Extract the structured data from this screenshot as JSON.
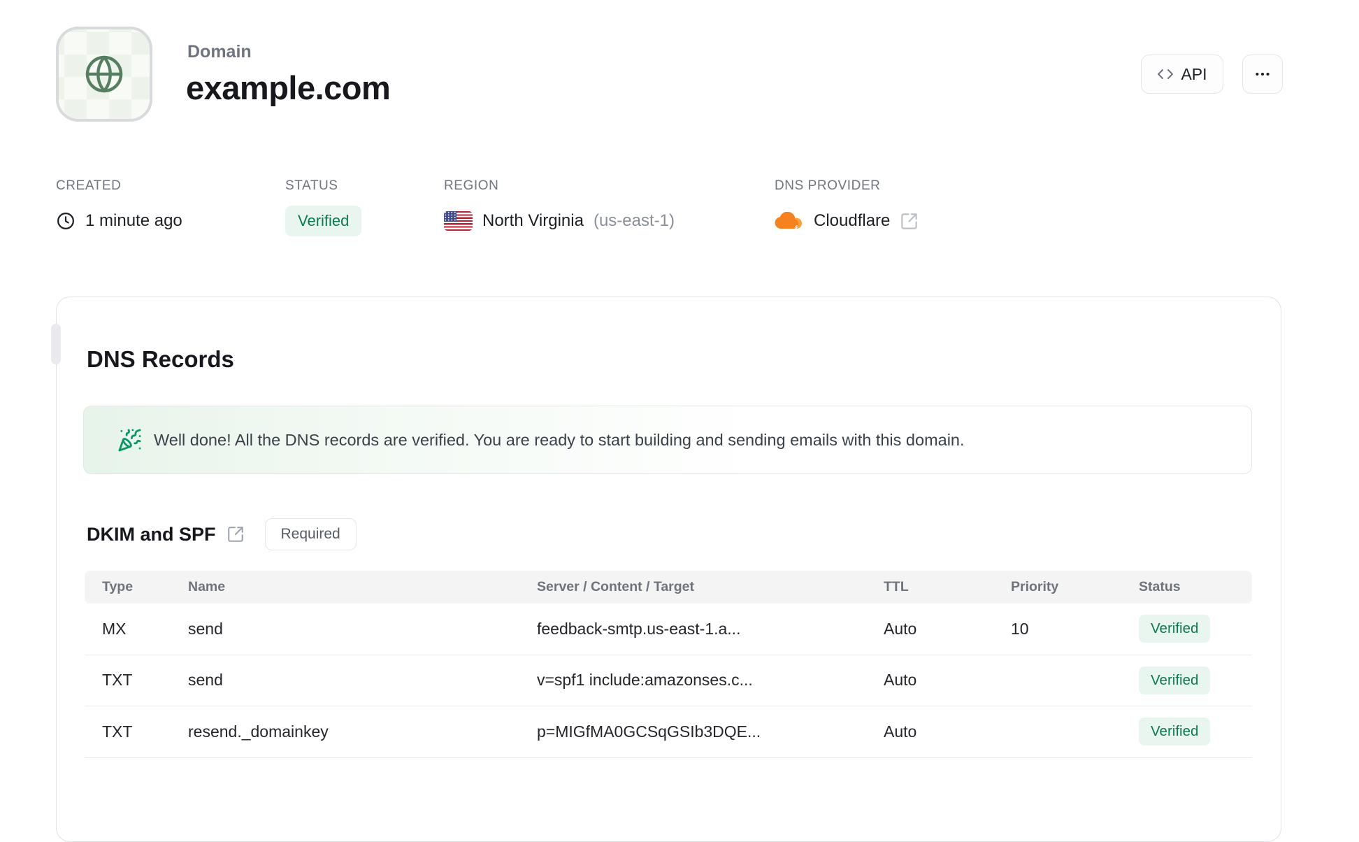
{
  "header": {
    "eyebrow": "Domain",
    "title": "example.com",
    "api_label": "API"
  },
  "meta": {
    "created_label": "CREATED",
    "created_value": "1 minute ago",
    "status_label": "STATUS",
    "status_value": "Verified",
    "region_label": "REGION",
    "region_value": "North Virginia",
    "region_code": "(us-east-1)",
    "dns_label": "DNS PROVIDER",
    "dns_value": "Cloudflare"
  },
  "dns_card": {
    "title": "DNS Records",
    "banner_text": "Well done! All the DNS records are verified. You are ready to start building and sending emails with this domain.",
    "section_title": "DKIM and SPF",
    "section_badge": "Required",
    "table": {
      "headers": [
        "Type",
        "Name",
        "Server / Content / Target",
        "TTL",
        "Priority",
        "Status"
      ],
      "rows": [
        {
          "type": "MX",
          "name": "send",
          "content": "feedback-smtp.us-east-1.a...",
          "ttl": "Auto",
          "priority": "10",
          "status": "Verified"
        },
        {
          "type": "TXT",
          "name": "send",
          "content": "v=spf1 include:amazonses.c...",
          "ttl": "Auto",
          "priority": "",
          "status": "Verified"
        },
        {
          "type": "TXT",
          "name": "resend._domainkey",
          "content": "p=MIGfMA0GCSqGSIb3DQE...",
          "ttl": "Auto",
          "priority": "",
          "status": "Verified"
        }
      ]
    }
  },
  "colors": {
    "accent_green": "#0b7a50",
    "badge_bg": "#e9f6ef",
    "globe_green": "#567f62",
    "cloudflare_orange": "#f6821f",
    "flag_red": "#b22234",
    "flag_blue": "#3f4a8c"
  }
}
